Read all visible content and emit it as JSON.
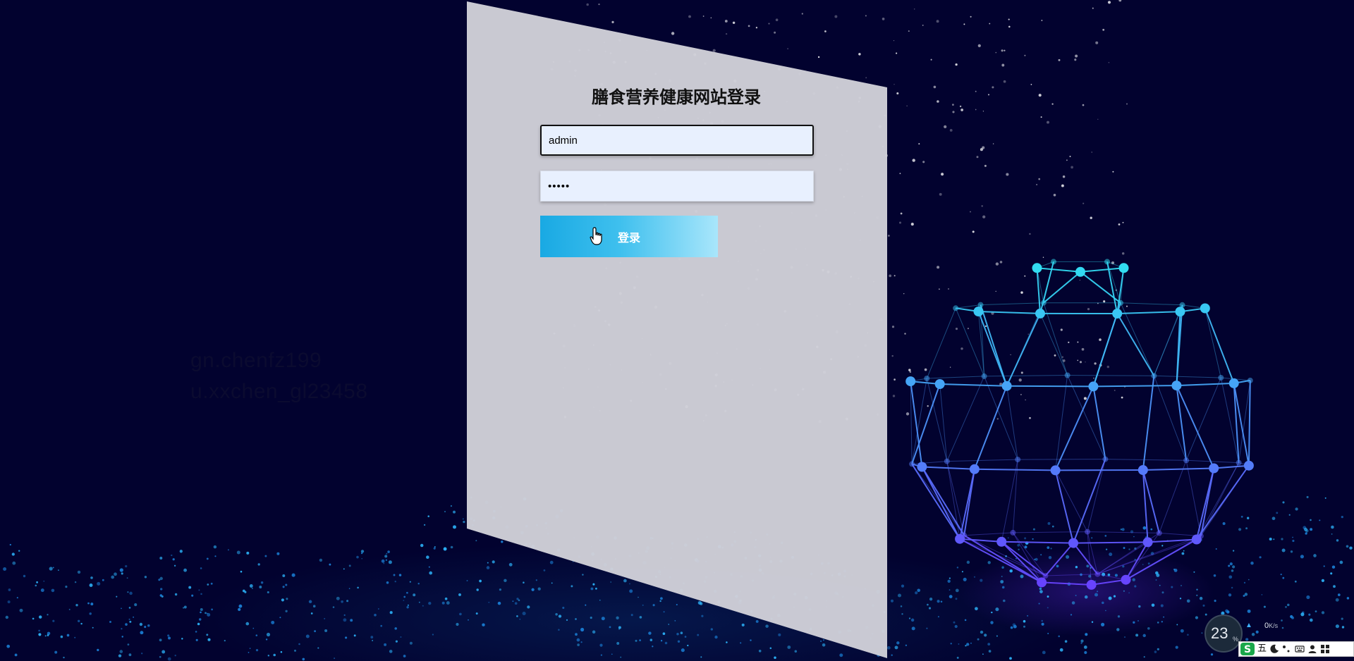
{
  "login": {
    "title": "膳食营养健康网站登录",
    "username_value": "admin",
    "password_value": "•••••",
    "login_button": "登录"
  },
  "watermark": {
    "line1": "gn.chenfz199",
    "line2": "u.xxchen_gl23458"
  },
  "tray": {
    "net_percent": "23",
    "net_percent_sign": "%",
    "net_speed": "0",
    "net_speed_unit": "K/s",
    "ime_mode": "五"
  },
  "colors": {
    "background": "#02022f",
    "panel": "#cfcfd8",
    "button_start": "#19a9e3",
    "button_end": "#a9e6fb",
    "input_bg": "#e8f0fe",
    "sphere_cyan": "#2ee6f0",
    "sphere_blue": "#3a6dff"
  },
  "icons": {
    "cursor": "hand-pointer-icon",
    "ime_logo": "sogou-s-icon",
    "moon": "moon-icon",
    "punctuation": "punctuation-icon",
    "keyboard": "keyboard-icon",
    "user": "user-icon",
    "grid": "grid-icon"
  }
}
